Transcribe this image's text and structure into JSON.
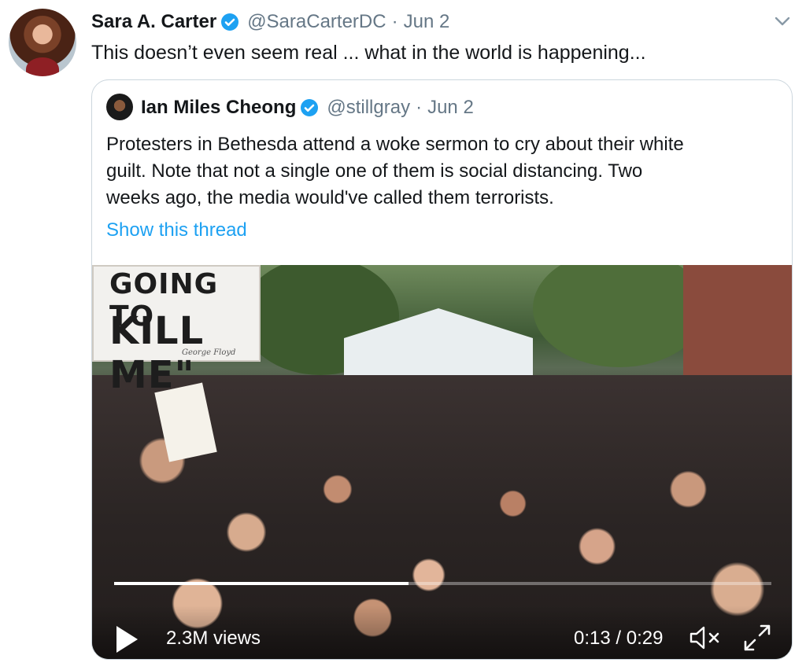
{
  "tweet": {
    "author_name": "Sara A. Carter",
    "handle": "@SaraCarterDC",
    "separator": "·",
    "date": "Jun 2",
    "text": "This doesn’t even seem real ... what in the world is happening..."
  },
  "quoted_tweet": {
    "author_name": "Ian Miles Cheong",
    "handle": "@stillgray",
    "separator": "·",
    "date": "Jun 2",
    "text_lines": [
      "Protesters in Bethesda attend a woke sermon to cry about their white",
      "guilt. Note that not a single one of them is social distancing. Two",
      "weeks ago, the media would've called them terrorists."
    ],
    "show_thread_label": "Show this thread"
  },
  "video": {
    "sign_line_1": "GOING TO",
    "sign_line_2": "KILL ME\"",
    "sign_credit": "George Floyd",
    "views": "2.3M views",
    "time": "0:13 / 0:29",
    "progress": 0.448
  },
  "colors": {
    "link": "#1da1f2",
    "secondary_text": "#657786",
    "verified_badge": "#1da1f2",
    "border": "#ccd6dd"
  },
  "icons": {
    "verified": "verified-badge-icon",
    "chevron": "chevron-down-icon",
    "play": "play-icon",
    "mute": "volume-muted-icon",
    "fullscreen": "fullscreen-icon"
  }
}
